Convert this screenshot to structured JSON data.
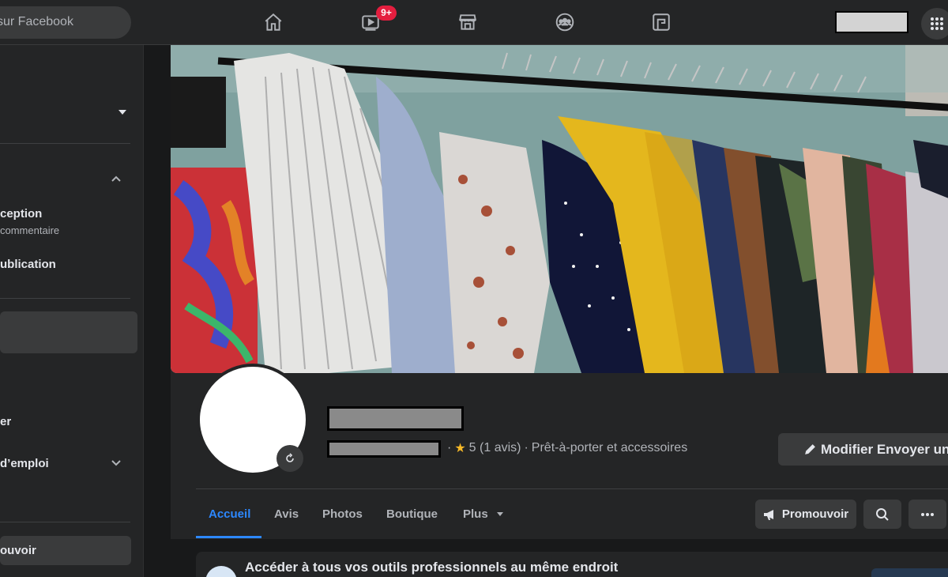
{
  "topbar": {
    "search_placeholder": "Rechercher sur Facebook",
    "search_visible": "sur Facebook",
    "watch_badge": "9+"
  },
  "sidebar": {
    "reception_label": "ception",
    "reception_sub": "commentaire",
    "publication_label": "ublication",
    "item_er": "er",
    "emploi_label": "d’emploi",
    "promote_button": "ouvoir"
  },
  "profile": {
    "rating": "5 (1 avis)",
    "category": "Prêt-à-porter et accessoires",
    "meta_separator": "·",
    "edit_button": "Modifier Envoyer un"
  },
  "tabs": [
    {
      "label": "Accueil",
      "active": true
    },
    {
      "label": "Avis",
      "active": false
    },
    {
      "label": "Photos",
      "active": false
    },
    {
      "label": "Boutique",
      "active": false
    },
    {
      "label": "Plus",
      "active": false
    }
  ],
  "actions": {
    "promote_label": "Promouvoir"
  },
  "card": {
    "title": "Accéder à tous vos outils professionnels au même endroit"
  },
  "colors": {
    "accent": "#2d88ff",
    "badge": "#e41e3f",
    "star": "#f7b928",
    "surface": "#242526",
    "background": "#18191a"
  }
}
